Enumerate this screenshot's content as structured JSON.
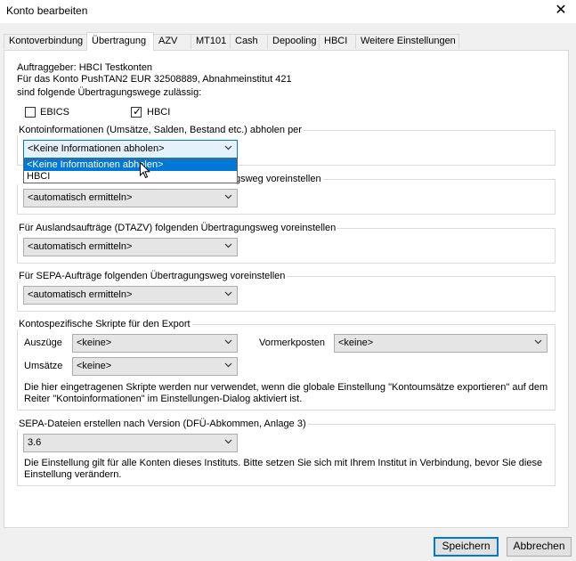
{
  "window": {
    "title": "Konto bearbeiten",
    "close_glyph": "✕"
  },
  "tabs": [
    {
      "label": "Kontoverbindung"
    },
    {
      "label": "Übertragung"
    },
    {
      "label": "AZV"
    },
    {
      "label": "MT101"
    },
    {
      "label": "Cash"
    },
    {
      "label": "Depooling"
    },
    {
      "label": "HBCI"
    },
    {
      "label": "Weitere Einstellungen"
    }
  ],
  "active_tab": "Übertragung",
  "info": {
    "line1": "Auftraggeber: HBCI Testkonten",
    "line2": "Für das Konto PushTAN2 EUR 32508889, Abnahmeinstitut 421",
    "line3": "sind folgende Übertragungswege zulässig:"
  },
  "channels": {
    "ebics": {
      "label": "EBICS",
      "checked": false
    },
    "hbci": {
      "label": "HBCI",
      "checked": true,
      "check_glyph": "✓"
    }
  },
  "kontoinfo": {
    "legend": "Kontoinformationen (Umsätze, Salden, Bestand etc.) abholen per",
    "value": "<Keine Informationen abholen>",
    "options": [
      "<Keine Informationen abholen>",
      "HBCI"
    ],
    "selected_index": 0
  },
  "inland": {
    "legend_visible": "gsweg voreinstellen",
    "value": "<automatisch ermitteln>"
  },
  "ausland": {
    "legend": "Für Auslandsaufträge (DTAZV) folgenden Übertragungsweg voreinstellen",
    "value": "<automatisch ermitteln>"
  },
  "sepa": {
    "legend": "Für SEPA-Aufträge folgenden Übertragungsweg voreinstellen",
    "value": "<automatisch ermitteln>"
  },
  "scripts": {
    "legend": "Kontospezifische Skripte für den Export",
    "auszuege_label": "Auszüge",
    "auszuege_value": "<keine>",
    "vormerk_label": "Vormerkposten",
    "vormerk_value": "<keine>",
    "umsaetze_label": "Umsätze",
    "umsaetze_value": "<keine>",
    "note1": "Die hier eingetragenen Skripte werden nur verwendet, wenn die globale Einstellung \"Kontoumsätze exportieren\" auf dem",
    "note2": "Reiter \"Kontoinformationen\" im Einstellungen-Dialog aktiviert ist."
  },
  "sepa_version": {
    "legend": "SEPA-Dateien erstellen nach Version (DFÜ-Abkommen, Anlage 3)",
    "value": "3.6",
    "note1": "Die Einstellung gilt für alle Konten dieses Instituts. Bitte setzen Sie sich mit Ihrem Institut in Verbindung, bevor Sie diese",
    "note2": "Einstellung verändern."
  },
  "buttons": {
    "save": "Speichern",
    "cancel": "Abbrechen"
  },
  "colors": {
    "selection": "#0078d7",
    "window_bg": "#f0f0f0",
    "panel_bg": "#ffffff"
  },
  "icons": {
    "dropdown": "chevron-down-icon",
    "cursor": "mouse-pointer-icon",
    "close": "close-icon"
  }
}
